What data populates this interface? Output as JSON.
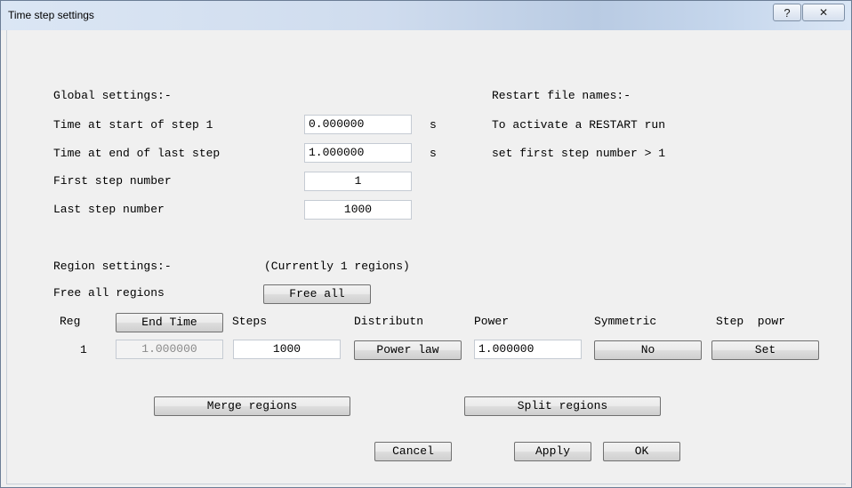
{
  "window": {
    "title": "Time step settings",
    "help_glyph": "?",
    "close_glyph": "✕"
  },
  "global": {
    "heading": "Global settings:-",
    "start_label": "Time at start of step 1",
    "start_value": "0.000000",
    "start_unit": "s",
    "end_label": "Time at end of last step",
    "end_value": "1.000000",
    "end_unit": "s",
    "first_label": "First step number",
    "first_value": "1",
    "last_label": "Last step number",
    "last_value": "1000"
  },
  "restart": {
    "heading": "Restart file names:-",
    "line1": "To activate a RESTART run",
    "line2": "set first step number > 1"
  },
  "region": {
    "heading": "Region settings:-",
    "count_text": "(Currently 1 regions)",
    "free_label": "Free all regions",
    "free_button": "Free all"
  },
  "table": {
    "col_reg": "Reg",
    "col_endtime_button": "End Time",
    "col_steps": "Steps",
    "col_distribution": "Distributn",
    "col_power": "Power",
    "col_symmetric": "Symmetric",
    "col_steppower": "Step  powr",
    "rows": [
      {
        "reg": "1",
        "end_time": "1.000000",
        "steps": "1000",
        "distribution": "Power law",
        "power": "1.000000",
        "symmetric": "No",
        "step_power": "Set"
      }
    ]
  },
  "actions": {
    "merge": "Merge regions",
    "split": "Split regions",
    "cancel": "Cancel",
    "apply": "Apply",
    "ok": "OK"
  }
}
